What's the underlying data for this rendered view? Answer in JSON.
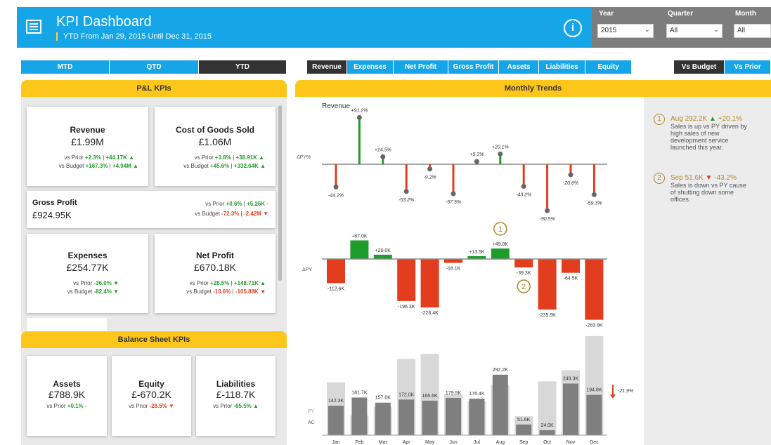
{
  "header": {
    "title": "KPI Dashboard",
    "subtitle": "YTD From Jan 29, 2015 Until Dec 31, 2015",
    "info_glyph": "i"
  },
  "filters": {
    "year_label": "Year",
    "year_value": "2015",
    "quarter_label": "Quarter",
    "quarter_value": "All",
    "month_label": "Month",
    "month_value": "All"
  },
  "period_tabs": [
    "MTD",
    "QTD",
    "YTD"
  ],
  "period_selected": "YTD",
  "measure_tabs": [
    "Revenue",
    "Expenses",
    "Net Profit",
    "Gross Profit",
    "Assets",
    "Liabilities",
    "Equity"
  ],
  "measure_selected": "Revenue",
  "compare_tabs": [
    "Vs Budget",
    "Vs Prior"
  ],
  "compare_selected": "Vs Budget",
  "pl": {
    "title": "P&L KPIs",
    "revenue": {
      "title": "Revenue",
      "value": "£1.99M",
      "prior_label": "vs Prior",
      "prior_pct": "+2.3%",
      "prior_sep": "|",
      "prior_abs": "+44.17K",
      "prior_arrow": "▲",
      "budget_label": "vs Budget",
      "budget_pct": "+167.3%",
      "budget_sep": "|",
      "budget_abs": "+4.94M",
      "budget_arrow": "▲"
    },
    "cogs": {
      "title": "Cost of Goods Sold",
      "value": "£1.06M",
      "prior_label": "vs Prior",
      "prior_pct": "+3.8%",
      "prior_sep": "|",
      "prior_abs": "+38.91K",
      "prior_arrow": "▲",
      "budget_label": "vs Budget",
      "budget_pct": "+45.6%",
      "budget_sep": "|",
      "budget_abs": "+332.64K",
      "budget_arrow": "▲"
    },
    "gross": {
      "title": "Gross Profit",
      "value": "£924.95K",
      "prior_label": "vs Prior",
      "prior_pct": "+0.6%",
      "prior_sep": "|",
      "prior_abs": "+5.26K",
      "prior_arrow": "-",
      "budget_label": "vs Budget",
      "budget_pct": "-72.3%",
      "budget_sep": "|",
      "budget_abs": "-2.42M",
      "budget_arrow": "▼"
    },
    "expenses": {
      "title": "Expenses",
      "value": "£254.77K",
      "prior_label": "vs Prior",
      "prior_pct": "-36.0%",
      "prior_arrow": "▼",
      "budget_label": "vs Budget",
      "budget_pct": "-82.4%",
      "budget_arrow": "▼"
    },
    "net": {
      "title": "Net Profit",
      "value": "£670.18K",
      "prior_label": "vs Prior",
      "prior_pct": "+28.5%",
      "prior_sep": "|",
      "prior_abs": "+148.71K",
      "prior_arrow": "▲",
      "budget_label": "vs Budget",
      "budget_pct": "-13.6%",
      "budget_sep": "|",
      "budget_abs": "-105.88K",
      "budget_arrow": "▼"
    }
  },
  "bs": {
    "title": "Balance Sheet KPIs",
    "assets": {
      "title": "Assets",
      "value": "£788.9K",
      "prior_label": "vs Prior",
      "prior_pct": "+0.1%",
      "prior_arrow": "-"
    },
    "equity": {
      "title": "Equity",
      "value": "£-670.2K",
      "prior_label": "vs Prior",
      "prior_pct": "-28.5%",
      "prior_arrow": "▼"
    },
    "liabilities": {
      "title": "Liabilities",
      "value": "£-118.7K",
      "prior_label": "vs Prior",
      "prior_pct": "-65.5%",
      "prior_arrow": "▲"
    }
  },
  "trends": {
    "title": "Monthly Trends",
    "notes": [
      {
        "num": "1",
        "head_a": "Aug 292.2K",
        "arrow": "▲",
        "head_b": "+20.1%",
        "text": [
          "Sales is up vs PY driven by",
          "high sales of new",
          "development service",
          "launched this year."
        ]
      },
      {
        "num": "2",
        "head_a": "Sep 51.6K",
        "arrow": "▼",
        "head_b": "-43.2%",
        "text": [
          "Sales is down vs PY cause",
          "of shutting down some",
          "offices."
        ]
      }
    ]
  },
  "colors": {
    "accent": "#16a6e8",
    "band": "#fcc61b",
    "positive": "#1f9d2a",
    "negative": "#e23d1f",
    "selected_tab": "#333333",
    "filter_bg": "#7d7d7d"
  },
  "chart_data": [
    {
      "type": "lollipop",
      "title": "Revenue",
      "ylabel": "ΔPY%",
      "categories": [
        "Jan",
        "Feb",
        "Mar",
        "Apr",
        "May",
        "Jun",
        "Jul",
        "Aug",
        "Sep",
        "Oct",
        "Nov",
        "Dec"
      ],
      "values": [
        -44.2,
        91.2,
        14.5,
        -53.2,
        -9.2,
        -57.5,
        5.3,
        20.1,
        -43.2,
        -90.5,
        -20.6,
        -59.3
      ],
      "labels": [
        "-44.2%",
        "+91.2%",
        "+14.5%",
        "-53.2%",
        "-9.2%",
        "-57.5%",
        "+5.3%",
        "+20.1%",
        "-43.2%",
        "-90.5%",
        "-20.6%",
        "-59.3%"
      ]
    },
    {
      "type": "bar",
      "ylabel": "ΔPY",
      "categories": [
        "Jan",
        "Feb",
        "Mar",
        "Apr",
        "May",
        "Jun",
        "Jul",
        "Aug",
        "Sep",
        "Oct",
        "Nov",
        "Dec"
      ],
      "values": [
        -112.6,
        87.0,
        20.0,
        -196.3,
        -226.4,
        -18.1,
        13.5,
        49.0,
        -39.3,
        -235.9,
        -64.5,
        -283.9
      ],
      "labels": [
        "-112.6K",
        "+87.0K",
        "+20.0K",
        "-196.3K",
        "-226.4K",
        "-18.1K",
        "+13.5K",
        "+49.0K",
        "-39.3K",
        "-235.9K",
        "-64.5K",
        "-283.9K"
      ],
      "annotations": [
        {
          "num": "1",
          "month": "Aug"
        },
        {
          "num": "2",
          "month": "Sep"
        }
      ]
    },
    {
      "type": "bar",
      "categories": [
        "Jan",
        "Feb",
        "Mar",
        "Apr",
        "May",
        "Jun",
        "Jul",
        "Aug",
        "Sep",
        "Oct",
        "Nov",
        "Dec"
      ],
      "series": [
        {
          "name": "PY",
          "values": [
            254.9,
            94.7,
            137.0,
            368.3,
            393.0,
            197.6,
            162.9,
            243.2,
            90.9,
            259.9,
            313.8,
            478.7
          ]
        },
        {
          "name": "AC",
          "values": [
            142.3,
            181.7,
            157.0,
            172.0,
            166.6,
            179.5,
            176.4,
            292.2,
            51.6,
            24.0,
            249.3,
            194.8
          ]
        }
      ],
      "labels": [
        "142.3K",
        "181.7K",
        "157.0K",
        "172.0K",
        "166.6K",
        "179.5K",
        "176.4K",
        "292.2K",
        "51.6K",
        "24.0K",
        "249.3K",
        "194.8K"
      ],
      "total_delta_label": "-21.9%"
    }
  ]
}
